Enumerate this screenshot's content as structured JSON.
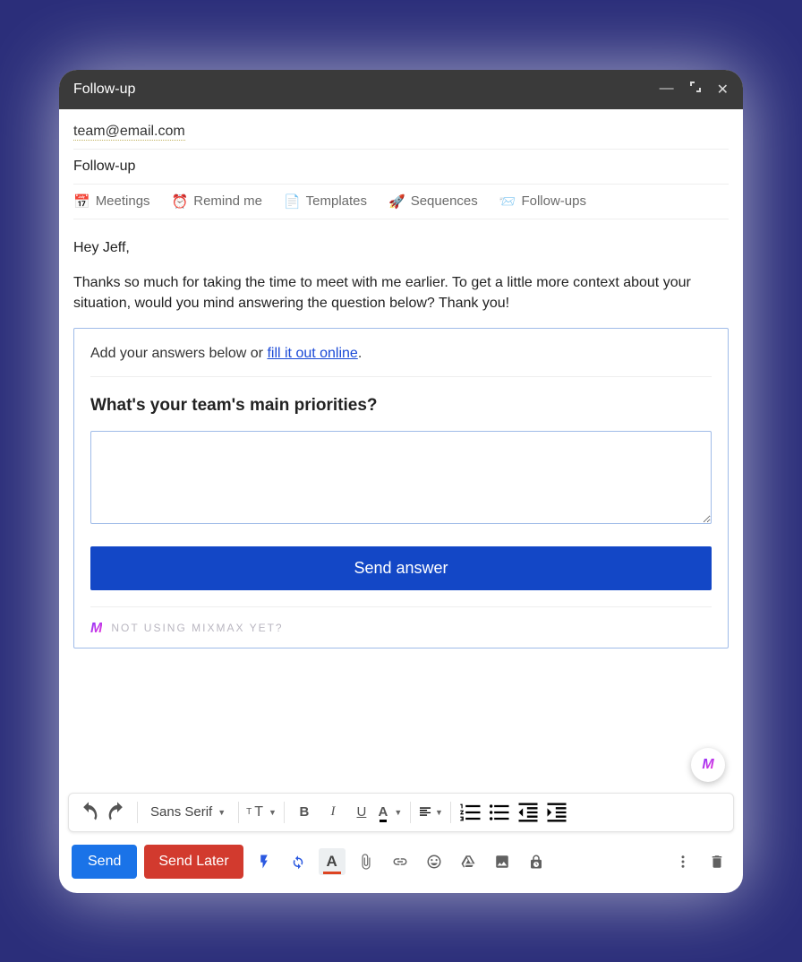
{
  "titlebar": {
    "title": "Follow-up"
  },
  "compose": {
    "to": "team@email.com",
    "subject": "Follow-up"
  },
  "mmbar": {
    "meetings": "Meetings",
    "remind": "Remind me",
    "templates": "Templates",
    "sequences": "Sequences",
    "followups": "Follow-ups"
  },
  "body": {
    "greeting": "Hey Jeff,",
    "para1": "Thanks so much for taking the time to meet with me earlier. To get a little more context about your situation, would you mind answering the question below? Thank you!"
  },
  "poll": {
    "lead_pre": "Add your answers below or ",
    "lead_link": "fill it out online",
    "lead_post": ".",
    "question": "What's your team's main priorities?",
    "send_label": "Send answer",
    "foot": "NOT USING MIXMAX YET?"
  },
  "format": {
    "font": "Sans Serif"
  },
  "actions": {
    "send": "Send",
    "later": "Send Later"
  }
}
